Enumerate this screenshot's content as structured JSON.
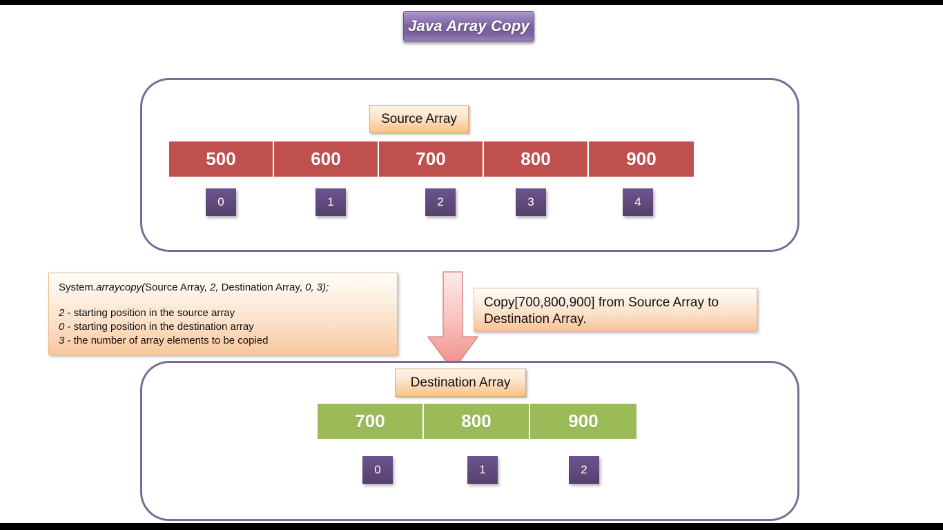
{
  "title": {
    "label": "Java Array Copy"
  },
  "source_section": {
    "chip_label": "Source Array",
    "cells": [
      "500",
      "600",
      "700",
      "800",
      "900"
    ],
    "indices": [
      "0",
      "1",
      "2",
      "3",
      "4"
    ],
    "cell_color": "#C0504D",
    "index_color": "#604A7B"
  },
  "destination_section": {
    "chip_label": "Destination Array",
    "cells": [
      "700",
      "800",
      "900"
    ],
    "indices": [
      "0",
      "1",
      "2"
    ],
    "cell_color": "#9BBB59",
    "index_color": "#604A7B"
  },
  "code_box": {
    "signature": {
      "part1": "System.",
      "part2": "arraycopy(",
      "part3": "Source Array, ",
      "part4": "2,",
      "part5": " Destination Array,",
      "part6": " 0, 3);"
    },
    "notes": [
      {
        "num": "2",
        "text": " - starting position in the source array"
      },
      {
        "num": "0",
        "text": " - starting position in the destination array"
      },
      {
        "num": "3",
        "text": " - the number of array elements to be copied"
      }
    ]
  },
  "callout": {
    "line1": "Copy[700,800,900] from Source Array to",
    "line2": "Destination Array."
  },
  "arrow": {
    "name": "down-arrow",
    "fill_top": "#FDE8E8",
    "fill_bottom": "#F08080",
    "stroke": "#D98D86"
  },
  "panel_border_color": "#7A6A96",
  "chip_accent_color": "#F9C28C"
}
